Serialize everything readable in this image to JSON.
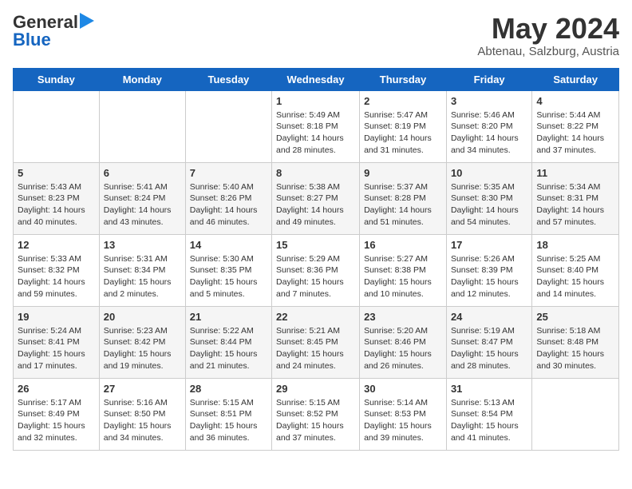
{
  "header": {
    "logo_line1": "General",
    "logo_line2": "Blue",
    "month": "May 2024",
    "location": "Abtenau, Salzburg, Austria"
  },
  "days_of_week": [
    "Sunday",
    "Monday",
    "Tuesday",
    "Wednesday",
    "Thursday",
    "Friday",
    "Saturday"
  ],
  "weeks": [
    [
      {
        "day": "",
        "sunrise": "",
        "sunset": "",
        "daylight": ""
      },
      {
        "day": "",
        "sunrise": "",
        "sunset": "",
        "daylight": ""
      },
      {
        "day": "",
        "sunrise": "",
        "sunset": "",
        "daylight": ""
      },
      {
        "day": "1",
        "sunrise": "Sunrise: 5:49 AM",
        "sunset": "Sunset: 8:18 PM",
        "daylight": "Daylight: 14 hours and 28 minutes."
      },
      {
        "day": "2",
        "sunrise": "Sunrise: 5:47 AM",
        "sunset": "Sunset: 8:19 PM",
        "daylight": "Daylight: 14 hours and 31 minutes."
      },
      {
        "day": "3",
        "sunrise": "Sunrise: 5:46 AM",
        "sunset": "Sunset: 8:20 PM",
        "daylight": "Daylight: 14 hours and 34 minutes."
      },
      {
        "day": "4",
        "sunrise": "Sunrise: 5:44 AM",
        "sunset": "Sunset: 8:22 PM",
        "daylight": "Daylight: 14 hours and 37 minutes."
      }
    ],
    [
      {
        "day": "5",
        "sunrise": "Sunrise: 5:43 AM",
        "sunset": "Sunset: 8:23 PM",
        "daylight": "Daylight: 14 hours and 40 minutes."
      },
      {
        "day": "6",
        "sunrise": "Sunrise: 5:41 AM",
        "sunset": "Sunset: 8:24 PM",
        "daylight": "Daylight: 14 hours and 43 minutes."
      },
      {
        "day": "7",
        "sunrise": "Sunrise: 5:40 AM",
        "sunset": "Sunset: 8:26 PM",
        "daylight": "Daylight: 14 hours and 46 minutes."
      },
      {
        "day": "8",
        "sunrise": "Sunrise: 5:38 AM",
        "sunset": "Sunset: 8:27 PM",
        "daylight": "Daylight: 14 hours and 49 minutes."
      },
      {
        "day": "9",
        "sunrise": "Sunrise: 5:37 AM",
        "sunset": "Sunset: 8:28 PM",
        "daylight": "Daylight: 14 hours and 51 minutes."
      },
      {
        "day": "10",
        "sunrise": "Sunrise: 5:35 AM",
        "sunset": "Sunset: 8:30 PM",
        "daylight": "Daylight: 14 hours and 54 minutes."
      },
      {
        "day": "11",
        "sunrise": "Sunrise: 5:34 AM",
        "sunset": "Sunset: 8:31 PM",
        "daylight": "Daylight: 14 hours and 57 minutes."
      }
    ],
    [
      {
        "day": "12",
        "sunrise": "Sunrise: 5:33 AM",
        "sunset": "Sunset: 8:32 PM",
        "daylight": "Daylight: 14 hours and 59 minutes."
      },
      {
        "day": "13",
        "sunrise": "Sunrise: 5:31 AM",
        "sunset": "Sunset: 8:34 PM",
        "daylight": "Daylight: 15 hours and 2 minutes."
      },
      {
        "day": "14",
        "sunrise": "Sunrise: 5:30 AM",
        "sunset": "Sunset: 8:35 PM",
        "daylight": "Daylight: 15 hours and 5 minutes."
      },
      {
        "day": "15",
        "sunrise": "Sunrise: 5:29 AM",
        "sunset": "Sunset: 8:36 PM",
        "daylight": "Daylight: 15 hours and 7 minutes."
      },
      {
        "day": "16",
        "sunrise": "Sunrise: 5:27 AM",
        "sunset": "Sunset: 8:38 PM",
        "daylight": "Daylight: 15 hours and 10 minutes."
      },
      {
        "day": "17",
        "sunrise": "Sunrise: 5:26 AM",
        "sunset": "Sunset: 8:39 PM",
        "daylight": "Daylight: 15 hours and 12 minutes."
      },
      {
        "day": "18",
        "sunrise": "Sunrise: 5:25 AM",
        "sunset": "Sunset: 8:40 PM",
        "daylight": "Daylight: 15 hours and 14 minutes."
      }
    ],
    [
      {
        "day": "19",
        "sunrise": "Sunrise: 5:24 AM",
        "sunset": "Sunset: 8:41 PM",
        "daylight": "Daylight: 15 hours and 17 minutes."
      },
      {
        "day": "20",
        "sunrise": "Sunrise: 5:23 AM",
        "sunset": "Sunset: 8:42 PM",
        "daylight": "Daylight: 15 hours and 19 minutes."
      },
      {
        "day": "21",
        "sunrise": "Sunrise: 5:22 AM",
        "sunset": "Sunset: 8:44 PM",
        "daylight": "Daylight: 15 hours and 21 minutes."
      },
      {
        "day": "22",
        "sunrise": "Sunrise: 5:21 AM",
        "sunset": "Sunset: 8:45 PM",
        "daylight": "Daylight: 15 hours and 24 minutes."
      },
      {
        "day": "23",
        "sunrise": "Sunrise: 5:20 AM",
        "sunset": "Sunset: 8:46 PM",
        "daylight": "Daylight: 15 hours and 26 minutes."
      },
      {
        "day": "24",
        "sunrise": "Sunrise: 5:19 AM",
        "sunset": "Sunset: 8:47 PM",
        "daylight": "Daylight: 15 hours and 28 minutes."
      },
      {
        "day": "25",
        "sunrise": "Sunrise: 5:18 AM",
        "sunset": "Sunset: 8:48 PM",
        "daylight": "Daylight: 15 hours and 30 minutes."
      }
    ],
    [
      {
        "day": "26",
        "sunrise": "Sunrise: 5:17 AM",
        "sunset": "Sunset: 8:49 PM",
        "daylight": "Daylight: 15 hours and 32 minutes."
      },
      {
        "day": "27",
        "sunrise": "Sunrise: 5:16 AM",
        "sunset": "Sunset: 8:50 PM",
        "daylight": "Daylight: 15 hours and 34 minutes."
      },
      {
        "day": "28",
        "sunrise": "Sunrise: 5:15 AM",
        "sunset": "Sunset: 8:51 PM",
        "daylight": "Daylight: 15 hours and 36 minutes."
      },
      {
        "day": "29",
        "sunrise": "Sunrise: 5:15 AM",
        "sunset": "Sunset: 8:52 PM",
        "daylight": "Daylight: 15 hours and 37 minutes."
      },
      {
        "day": "30",
        "sunrise": "Sunrise: 5:14 AM",
        "sunset": "Sunset: 8:53 PM",
        "daylight": "Daylight: 15 hours and 39 minutes."
      },
      {
        "day": "31",
        "sunrise": "Sunrise: 5:13 AM",
        "sunset": "Sunset: 8:54 PM",
        "daylight": "Daylight: 15 hours and 41 minutes."
      },
      {
        "day": "",
        "sunrise": "",
        "sunset": "",
        "daylight": ""
      }
    ]
  ]
}
